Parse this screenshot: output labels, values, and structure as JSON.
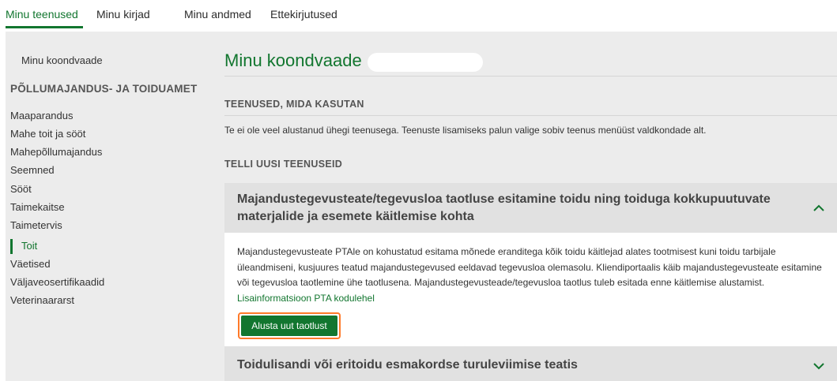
{
  "topnav": {
    "tabs": [
      "Minu teenused",
      "Minu kirjad",
      "Minu andmed",
      "Ettekirjutused"
    ],
    "active_tab": "Minu teenused"
  },
  "sidebar": {
    "overview_link": "Minu koondvaade",
    "section_heading": "PÕLLUMAJANDUS- JA TOIDUAMET",
    "items": [
      "Maaparandus",
      "Mahe toit ja sööt",
      "Mahepõllumajandus",
      "Seemned",
      "Sööt",
      "Taimekaitse",
      "Taimetervis",
      "Toit",
      "Väetised",
      "Väljaveosertifikaadid",
      "Veterinaararst"
    ],
    "active_item": "Toit"
  },
  "main": {
    "title": "Minu koondvaade",
    "services_heading": "TEENUSED, MIDA KASUTAN",
    "services_empty_text": "Te ei ole veel alustanud ühegi teenusega. Teenuste lisamiseks palun valige sobiv teenus menüüst valdkondade alt.",
    "order_heading": "TELLI UUSI TEENUSEID",
    "accordions": [
      {
        "title": "Majandustegevusteate/tegevusloa taotluse esitamine toidu ning toiduga kokkupuutuvate materjalide ja esemete käitlemise kohta",
        "expanded": true,
        "description": "Majandustegevusteate PTAle on kohustatud esitama mõnede eranditega kõik toidu käitlejad alates tootmisest kuni toidu tarbijale üleandmiseni, kusjuures teatud majandustegevused eeldavad tegevusloa olemasolu. Kliendiportaalis käib majandustegevusteate esitamine või tegevusloa taotlemine ühe taotlusena. Majandustegevusteade/tegevusloa taotlus tuleb esitada enne käitlemise alustamist.",
        "link_text": "Lisainformatsioon PTA kodulehel",
        "button_label": "Alusta uut taotlust"
      },
      {
        "title": "Toidulisandi või eritoidu esmakordse turuleviimise teatis",
        "expanded": false
      }
    ]
  },
  "colors": {
    "brand_green": "#12762f",
    "focus_orange": "#ff7a2a",
    "frame_grey": "#ececec"
  }
}
